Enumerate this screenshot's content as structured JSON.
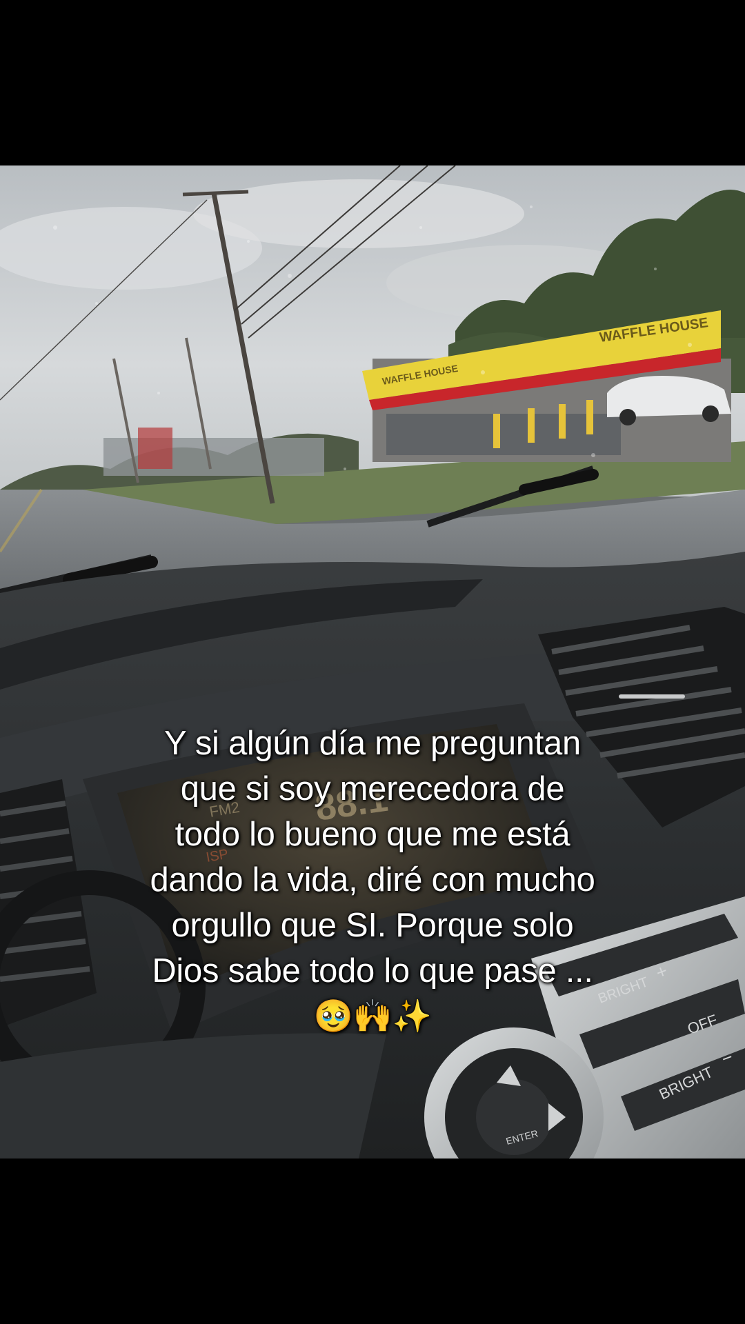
{
  "caption": {
    "lines": [
      "Y si algún día me preguntan",
      "que si soy merecedora de",
      "todo lo bueno que me está",
      "dando la vida, diré con mucho",
      "orgullo que SI. Porque solo",
      "Dios sabe todo lo que pase ..."
    ],
    "emoji": "🥹🙌✨"
  },
  "scene": {
    "store_sign": "WAFFLE HOUSE",
    "store_sign_left": "WAFFLE HOUSE",
    "radio_band": "FM2",
    "radio_frequency": "88.1",
    "radio_label": "ISP",
    "control_labels": {
      "bright_up": "BRIGHT",
      "bright_down": "BRIGHT",
      "off": "OFF",
      "plus": "+",
      "minus": "−",
      "enter": "ENTER"
    }
  },
  "colors": {
    "sky": "#c9cdd0",
    "sign_yellow": "#e8d23a",
    "sign_red": "#c8262b",
    "dashboard": "#2e3133",
    "caption_text": "#ffffff"
  }
}
